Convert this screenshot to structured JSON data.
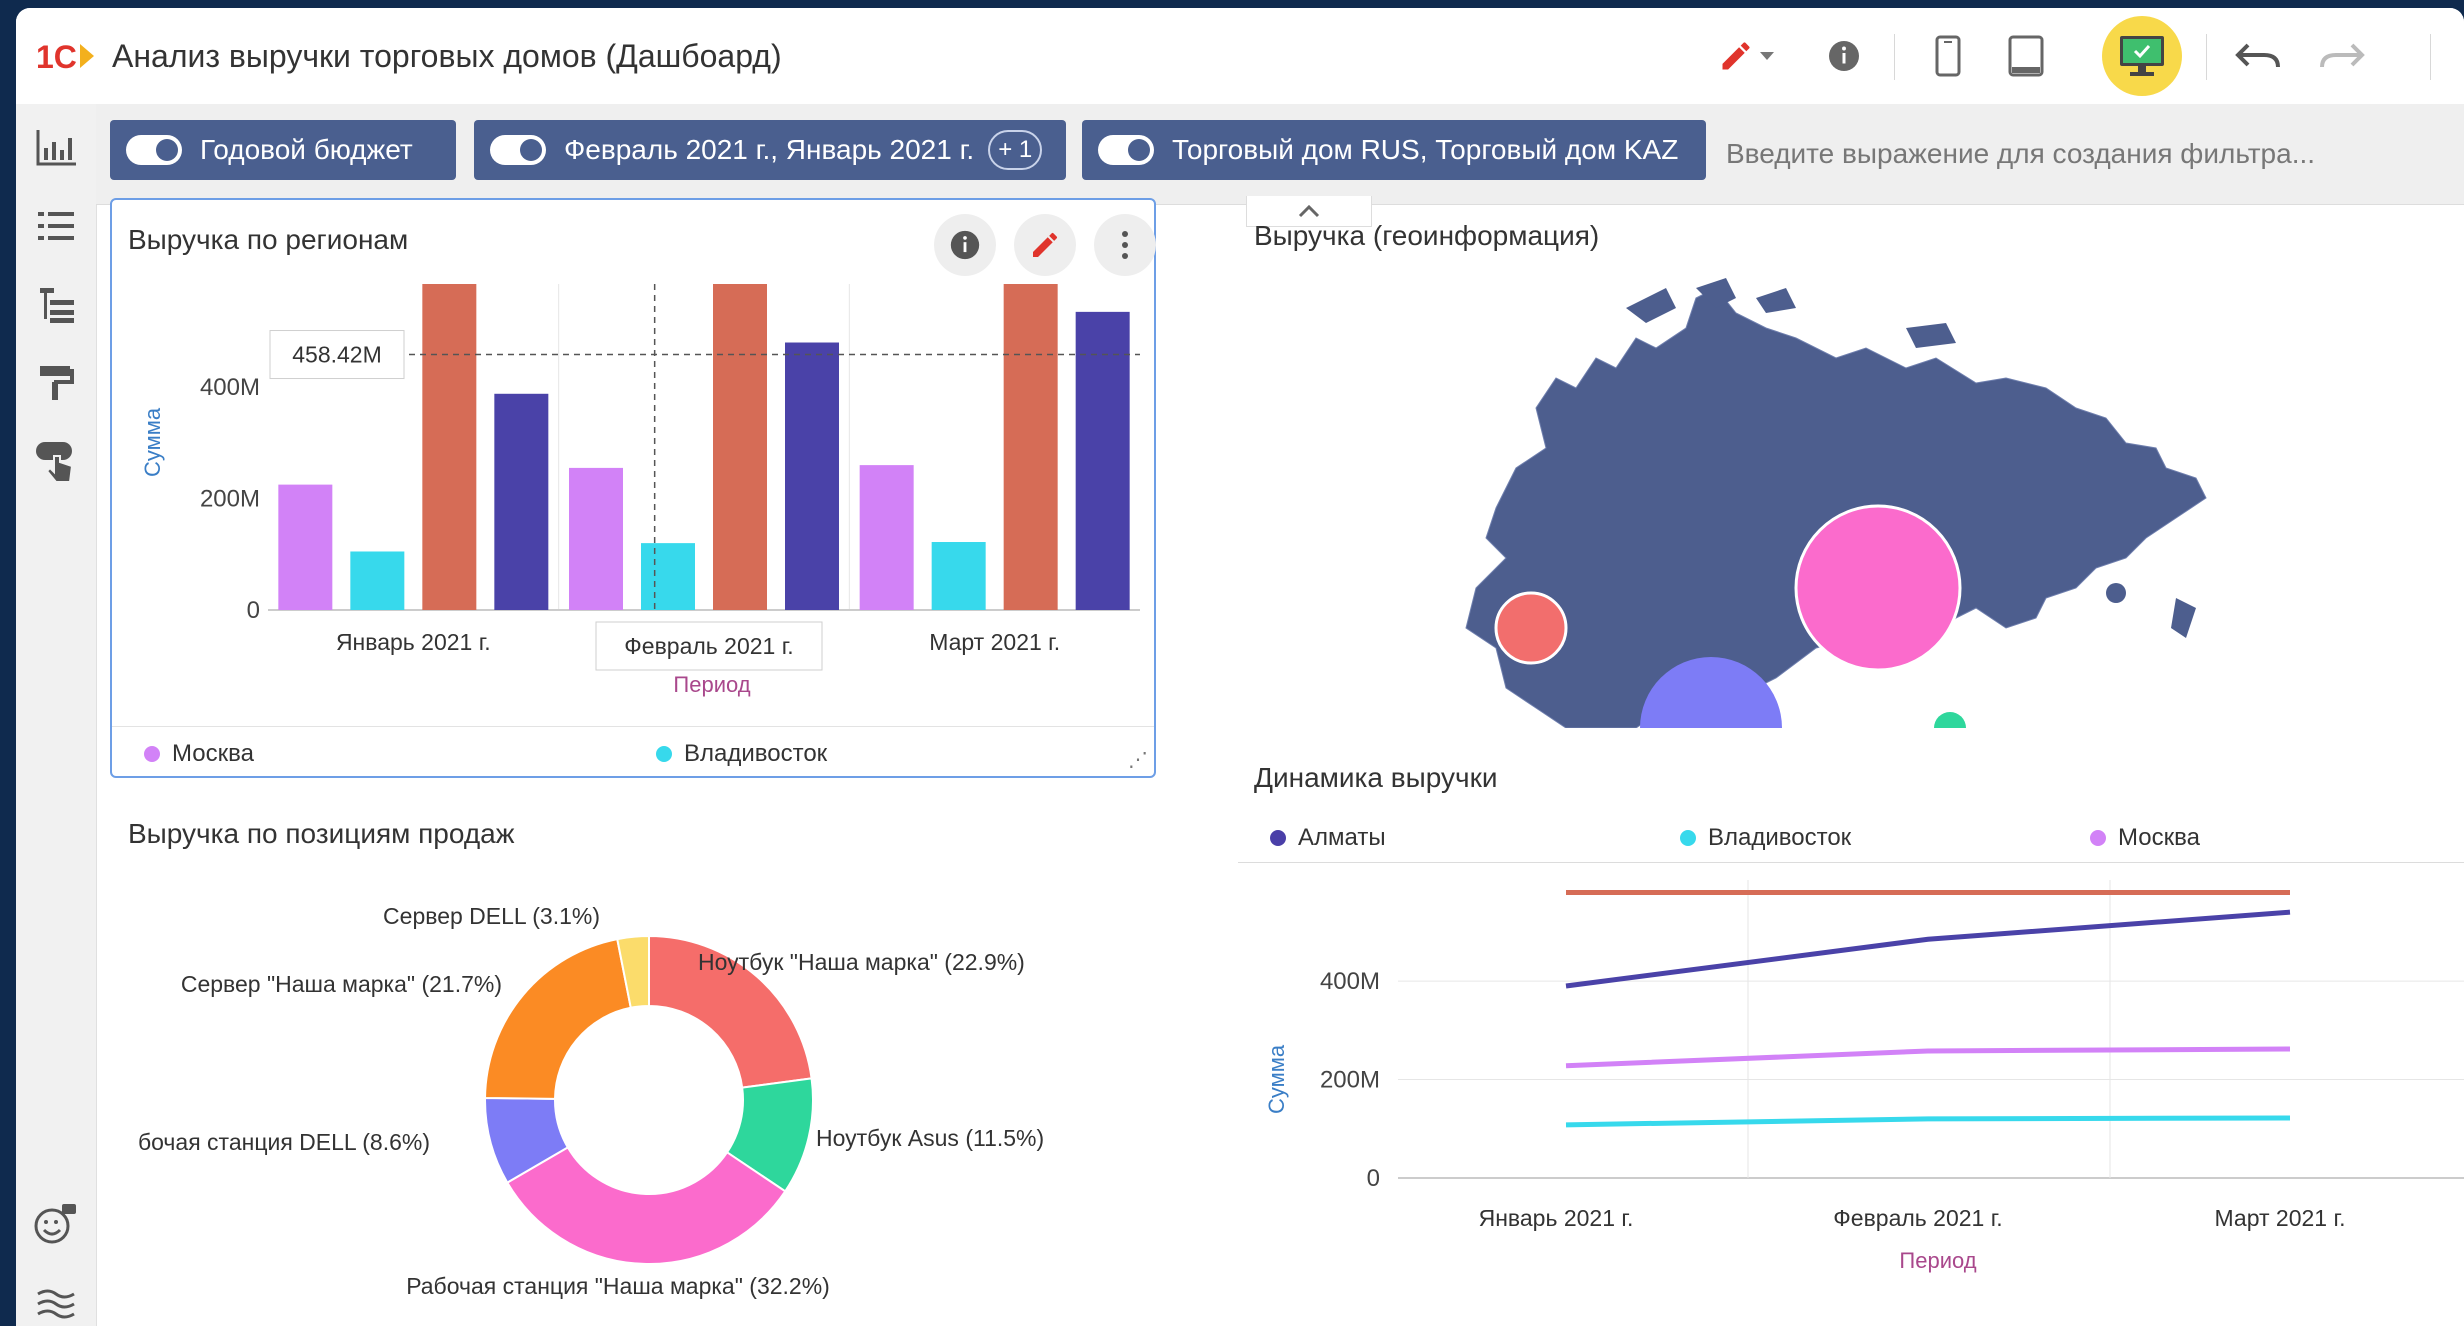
{
  "app": {
    "title": "Анализ выручки торговых домов (Дашбоард)",
    "logo_text": "1С"
  },
  "toolbar": {
    "icons": [
      "edit-pencil-icon",
      "chevron-down-icon",
      "info-icon",
      "phone-icon",
      "tablet-icon",
      "desktop-icon",
      "undo-icon",
      "redo-icon"
    ],
    "accent": "#f8d94a"
  },
  "sidebar": {
    "icons": [
      "chart-icon",
      "list-icon",
      "tree-icon",
      "paint-roller-icon",
      "touch-icon",
      "emoji-icon",
      "layers-icon"
    ]
  },
  "filters": {
    "chips": [
      {
        "label": "Годовой бюджет"
      },
      {
        "label": "Февраль 2021 г., Январь 2021 г.",
        "extra": "+ 1"
      },
      {
        "label": "Торговый дом RUS, Торговый дом KAZ"
      }
    ],
    "input_placeholder": "Введите выражение для создания фильтра...",
    "chip_color": "#4a5f8f"
  },
  "bar_panel": {
    "title": "Выручка по регионам",
    "tooltip_value": "458.42M",
    "tooltip_category": "Февраль 2021 г.",
    "legend": [
      {
        "name": "Москва",
        "color": "#d282f7"
      },
      {
        "name": "Владивосток",
        "color": "#37d9ec"
      }
    ]
  },
  "geo_panel": {
    "title": "Выручка (геоинформация)"
  },
  "pie_panel": {
    "title": "Выручка по позициям продаж"
  },
  "line_panel": {
    "title": "Динамика выручки",
    "legend": [
      {
        "name": "Алматы",
        "color": "#4a3fa8"
      },
      {
        "name": "Владивосток",
        "color": "#37d9ec"
      },
      {
        "name": "Москва",
        "color": "#d282f7"
      }
    ]
  },
  "chart_data": [
    {
      "type": "bar",
      "title": "Выручка по регионам",
      "xlabel": "Период",
      "ylabel": "Сумма",
      "categories": [
        "Январь 2021 г.",
        "Февраль 2021 г.",
        "Март 2021 г."
      ],
      "yticks": [
        "0",
        "200M",
        "400M"
      ],
      "ylim": [
        0,
        585
      ],
      "series": [
        {
          "name": "Москва",
          "color": "#d282f7",
          "values": [
            225,
            255,
            260
          ]
        },
        {
          "name": "Владивосток",
          "color": "#37d9ec",
          "values": [
            105,
            120,
            122
          ]
        },
        {
          "color": "#d66c56",
          "values": [
            585,
            585,
            585
          ]
        },
        {
          "color": "#4a42a8",
          "values": [
            388,
            480,
            535
          ]
        }
      ],
      "reference_line": 458.42
    },
    {
      "type": "pie",
      "title": "Выручка по позициям продаж",
      "slices": [
        {
          "label": "Ноутбук \"Наша марка\" (22.9%)",
          "value": 22.9,
          "color": "#f56d6a"
        },
        {
          "label": "Ноутбук Asus (11.5%)",
          "value": 11.5,
          "color": "#2ed79c"
        },
        {
          "label": "Рабочая станция \"Наша марка\" (32.2%)",
          "value": 32.2,
          "color": "#fb6bcc"
        },
        {
          "label": "бочая станция DELL (8.6%)",
          "value": 8.6,
          "color": "#7d7cf6"
        },
        {
          "label": "Сервер \"Наша марка\" (21.7%)",
          "value": 21.7,
          "color": "#fb8b24"
        },
        {
          "label": "Сервер DELL (3.1%)",
          "value": 3.1,
          "color": "#fbdc6b"
        }
      ]
    },
    {
      "type": "line",
      "title": "Динамика выручки",
      "xlabel": "Период",
      "ylabel": "Сумма",
      "categories": [
        "Январь 2021 г.",
        "Февраль 2021 г.",
        "Март 2021 г."
      ],
      "yticks": [
        "0",
        "200M",
        "400M"
      ],
      "ylim": [
        0,
        585
      ],
      "series": [
        {
          "name": "Алматы",
          "color": "#4a42a8",
          "values": [
            390,
            485,
            540
          ]
        },
        {
          "name": "Владивосток",
          "color": "#37d9ec",
          "values": [
            108,
            120,
            122
          ]
        },
        {
          "name": "Москва",
          "color": "#d282f7",
          "values": [
            228,
            258,
            262
          ]
        },
        {
          "color": "#d66c56",
          "values": [
            580,
            580,
            580
          ]
        }
      ]
    }
  ]
}
